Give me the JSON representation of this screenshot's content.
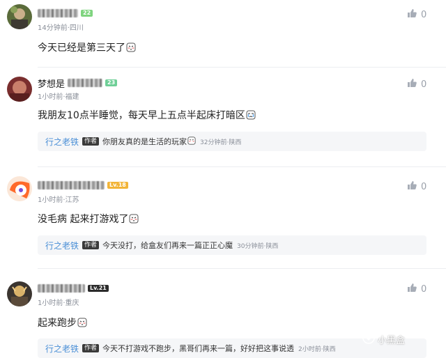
{
  "comments": [
    {
      "level": "22",
      "level_color": "#7fd47f",
      "meta": "14分钟前·四川",
      "text": "今天已经是第三天了",
      "likes": "0"
    },
    {
      "name_visible": "梦想是",
      "level": "23",
      "level_color": "#6fcf97",
      "meta": "1小时前·福建",
      "text": "我朋友10点半睡觉，每天早上五点半起床打暗区",
      "likes": "0",
      "reply": {
        "user": "行之老铁",
        "tag": "作者",
        "text": "你朋友真的是生活的玩家",
        "meta": "32分钟前·陕西"
      }
    },
    {
      "level": "Lv.18",
      "level_color": "#f2b437",
      "meta": "1小时前·江苏",
      "text": "没毛病 起来打游戏了",
      "likes": "0",
      "reply": {
        "user": "行之老铁",
        "tag": "作者",
        "text": "今天没打，给盒友们再来一篇正正心魔",
        "meta": "30分钟前·陕西"
      }
    },
    {
      "level": "Lv.21",
      "level_color": "#2b2b2b",
      "meta": "1小时前·重庆",
      "text": "起来跑步",
      "likes": "0",
      "reply": {
        "user": "行之老铁",
        "tag": "作者",
        "text": "今天不打游戏不跑步，黑哥们再来一篇，好好把这事说透",
        "meta": "2小时前·陕西"
      }
    }
  ],
  "watermark": "小黑盒",
  "icons": [
    "thumb-up-icon",
    "blush-emoji-icon",
    "xiaoheihe-logo-icon"
  ]
}
